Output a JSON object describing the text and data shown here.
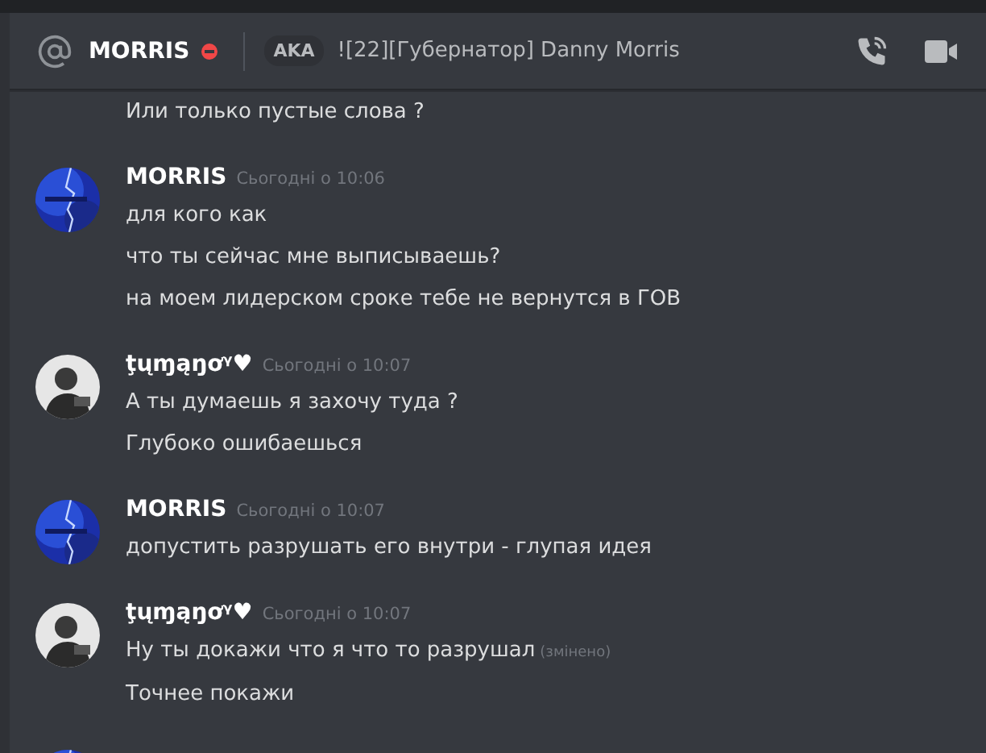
{
  "header": {
    "username": "MORRIS",
    "do_not_disturb": true,
    "aka_label": "AKA",
    "aka_name": "![22][Губернатор] Danny Morris"
  },
  "messages": [
    {
      "kind": "continuation",
      "lines": [
        {
          "text": "Или только пустые слова ?"
        }
      ]
    },
    {
      "kind": "group",
      "author": "MORRIS",
      "timestamp": "Сьогодні о 10:06",
      "lines": [
        {
          "text": "для кого как"
        },
        {
          "text": "что ты сейчас мне выписываешь?"
        },
        {
          "text": "на моем лидерском сроке тебе не вернутся в ГОВ"
        }
      ]
    },
    {
      "kind": "group",
      "author": "ţųɱąŋơᵞ♥",
      "timestamp": "Сьогодні о 10:07",
      "lines": [
        {
          "text": "А ты думаешь я захочу туда ?"
        },
        {
          "text": "Глубоко ошибаешься"
        }
      ]
    },
    {
      "kind": "group",
      "author": "MORRIS",
      "timestamp": "Сьогодні о 10:07",
      "lines": [
        {
          "text": "допустить разрушать его внутри - глупая идея"
        }
      ]
    },
    {
      "kind": "group",
      "author": "ţųɱąŋơᵞ♥",
      "timestamp": "Сьогодні о 10:07",
      "lines": [
        {
          "text": "Ну ты докажи что я что то разрушал",
          "edited": "(змінено)"
        },
        {
          "text": "Точнее покажи"
        }
      ]
    },
    {
      "kind": "cut_off"
    }
  ]
}
